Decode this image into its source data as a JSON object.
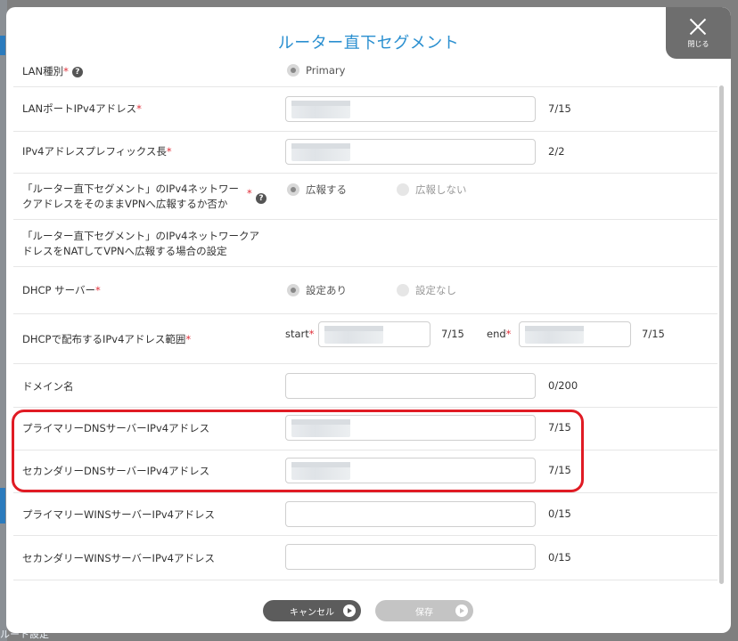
{
  "modal": {
    "title": "ルーター直下セグメント",
    "close_label": "閉じる"
  },
  "form": {
    "lan_type": {
      "label": "LAN種別",
      "options": [
        "Primary"
      ],
      "selected": "Primary"
    },
    "lan_port_ipv4": {
      "label": "LANポートIPv4アドレス",
      "count": "7/15"
    },
    "ipv4_prefix": {
      "label": "IPv4アドレスプレフィックス長",
      "count": "2/2"
    },
    "advertise_vpn": {
      "label_line1": "「ルーター直下セグメント」のIPv4ネットワー",
      "label_line2": "クアドレスをそのままVPNへ広報するか否か",
      "options": [
        "広報する",
        "広報しない"
      ],
      "selected": "広報する"
    },
    "nat_settings": {
      "label_line1": "「ルーター直下セグメント」のIPv4ネットワークア",
      "label_line2": "ドレスをNATしてVPNへ広報する場合の設定"
    },
    "dhcp_server": {
      "label": "DHCP サーバー",
      "options": [
        "設定あり",
        "設定なし"
      ],
      "selected": "設定あり"
    },
    "dhcp_range": {
      "label": "DHCPで配布するIPv4アドレス範囲",
      "start_label": "start",
      "start_count": "7/15",
      "end_label": "end",
      "end_count": "7/15"
    },
    "domain_name": {
      "label": "ドメイン名",
      "count": "0/200"
    },
    "primary_dns": {
      "label": "プライマリーDNSサーバーIPv4アドレス",
      "count": "7/15"
    },
    "secondary_dns": {
      "label": "セカンダリーDNSサーバーIPv4アドレス",
      "count": "7/15"
    },
    "primary_wins": {
      "label": "プライマリーWINSサーバーIPv4アドレス",
      "count": "0/15"
    },
    "secondary_wins": {
      "label": "セカンダリーWINSサーバーIPv4アドレス",
      "count": "0/15"
    }
  },
  "buttons": {
    "cancel": "キャンセル",
    "save": "保存"
  },
  "background": {
    "fragment_bottom": "ルート設定"
  },
  "required_mark": "*",
  "help_mark": "?",
  "colors": {
    "title": "#2a8fd0",
    "required": "#e0303a",
    "highlight": "#e01b24"
  }
}
